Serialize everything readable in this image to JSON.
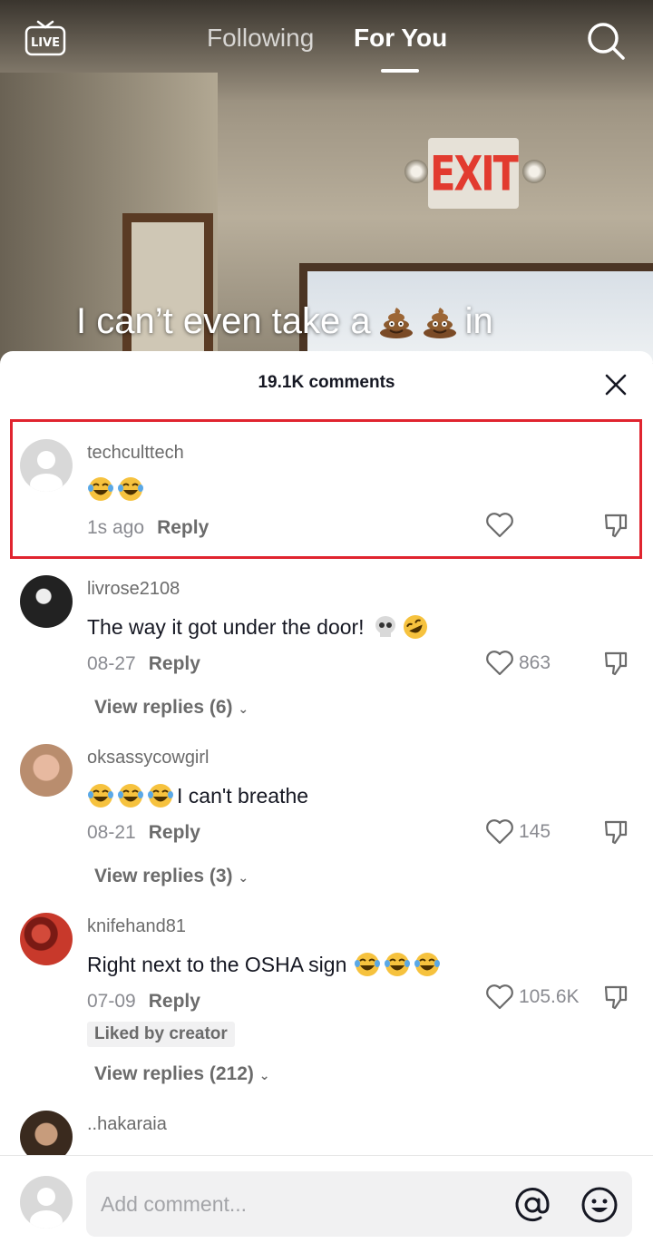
{
  "top_nav": {
    "live_label": "LIVE",
    "tabs": [
      {
        "label": "Following",
        "active": false
      },
      {
        "label": "For You",
        "active": true
      }
    ]
  },
  "video": {
    "exit_sign": "EXIT",
    "caption_before": "I can’t even take a",
    "caption_after": "in",
    "caption_emojis": [
      "poop-emoji",
      "poop-emoji"
    ]
  },
  "comments_sheet": {
    "title": "19.1K comments",
    "comments": [
      {
        "username": "techculttech",
        "text": "",
        "emojis": [
          "laughing-crying-emoji",
          "laughing-crying-emoji"
        ],
        "time": "1s ago",
        "reply_label": "Reply",
        "likes": "",
        "highlighted": true
      },
      {
        "username": "livrose2108",
        "text": "The way it got under the door!",
        "emojis": [
          "skull-emoji",
          "rolling-laughing-emoji"
        ],
        "time": "08-27",
        "reply_label": "Reply",
        "likes": "863",
        "view_replies": "View replies (6)"
      },
      {
        "username": "oksassycowgirl",
        "text": "I can't breathe",
        "emojis": [
          "laughing-crying-emoji",
          "laughing-crying-emoji",
          "laughing-crying-emoji"
        ],
        "time": "08-21",
        "reply_label": "Reply",
        "likes": "145",
        "view_replies": "View replies (3)"
      },
      {
        "username": "knifehand81",
        "text": "Right next to the OSHA sign",
        "emojis": [
          "laughing-crying-emoji",
          "laughing-crying-emoji",
          "laughing-crying-emoji"
        ],
        "time": "07-09",
        "reply_label": "Reply",
        "likes": "105.6K",
        "badge": "Liked by creator",
        "view_replies": "View replies (212)"
      },
      {
        "username": "..hakaraia"
      }
    ]
  },
  "composer": {
    "placeholder": "Add comment...",
    "value": ""
  },
  "colors": {
    "highlight_border": "#e0242f",
    "text_primary": "#161823",
    "text_secondary": "#8a8b91",
    "input_bg": "#f1f1f2"
  }
}
